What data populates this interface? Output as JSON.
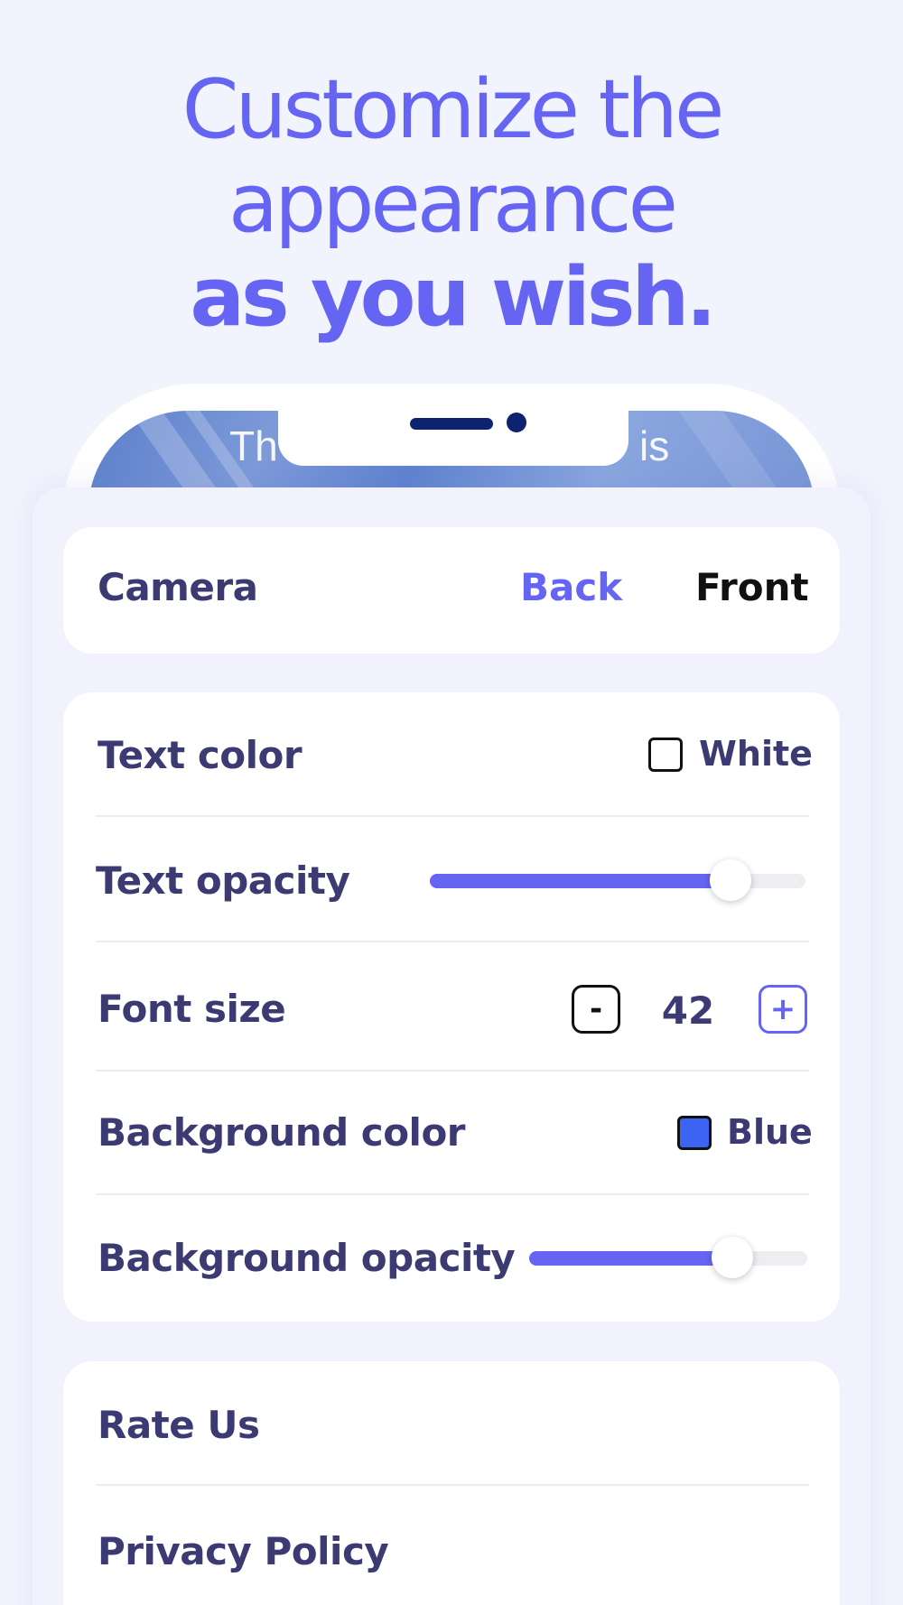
{
  "headline": {
    "line1": "Customize the",
    "line2": "appearance",
    "line3": "as you wish."
  },
  "preview": {
    "text_left": "Th",
    "text_right": "is"
  },
  "camera": {
    "label": "Camera",
    "options": [
      "Back",
      "Front"
    ],
    "selected": "Back"
  },
  "settings": {
    "text_color": {
      "label": "Text color",
      "value": "White",
      "swatch": "#ffffff"
    },
    "text_opacity": {
      "label": "Text opacity",
      "level": 0.8
    },
    "font_size": {
      "label": "Font size",
      "minus": "-",
      "value": "42",
      "plus": "+"
    },
    "background_color": {
      "label": "Background color",
      "value": "Blue",
      "swatch": "#3d63f2"
    },
    "background_opacity": {
      "label": "Background opacity",
      "level": 0.73
    }
  },
  "links": {
    "rate_us": "Rate Us",
    "privacy_policy": "Privacy Policy"
  },
  "colors": {
    "accent": "#6664f2",
    "label": "#3b3a72",
    "background": "#f1f3fd"
  }
}
